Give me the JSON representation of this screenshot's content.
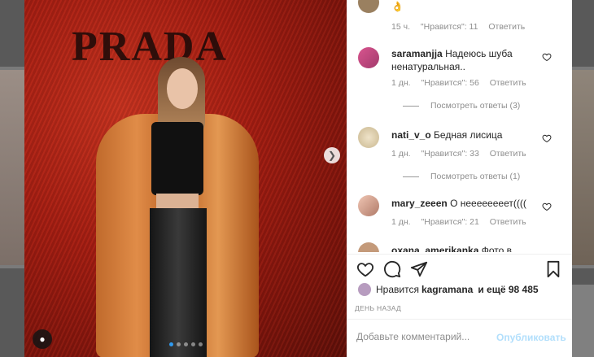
{
  "colors": {
    "accent": "#0095f6",
    "publish_disabled": "#b2dffc",
    "muted": "#8e8e8e"
  },
  "photo": {
    "brand_text": "PRADA",
    "carousel_dots": 5,
    "active_dot": 0
  },
  "comments": [
    {
      "user": "",
      "text": "👌",
      "time": "15 ч.",
      "likes": "\"Нравится\": 11",
      "reply": "Ответить",
      "replies": ""
    },
    {
      "user": "saramanjja",
      "text": "Надеюсь шуба ненатуральная..",
      "time": "1 дн.",
      "likes": "\"Нравится\": 56",
      "reply": "Ответить",
      "replies": "Посмотреть ответы (3)"
    },
    {
      "user": "nati_v_o",
      "text": "Бедная лисица",
      "time": "1 дн.",
      "likes": "\"Нравится\": 33",
      "reply": "Ответить",
      "replies": "Посмотреть ответы (1)"
    },
    {
      "user": "mary_zeeen",
      "text": "О неееееееет((((",
      "time": "1 дн.",
      "likes": "\"Нравится\": 21",
      "reply": "Ответить",
      "replies": ""
    },
    {
      "user": "oxana_amerikanka",
      "text": "Фото в такой",
      "time": "",
      "likes": "",
      "reply": "",
      "replies": ""
    }
  ],
  "likes": {
    "prefix": "Нравится",
    "user": "kagramana",
    "suffix": "и ещё 98 485"
  },
  "posted": "ДЕНЬ НАЗАД",
  "composer": {
    "placeholder": "Добавьте комментарий...",
    "publish": "Опубликовать"
  }
}
